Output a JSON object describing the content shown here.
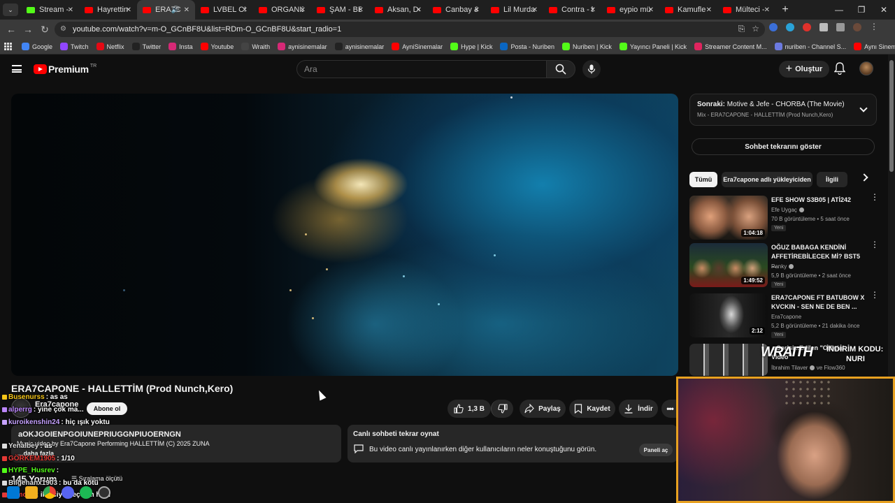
{
  "browser": {
    "tabs": [
      {
        "title": "Stream - K",
        "favicon": "kick-icon"
      },
      {
        "title": "Hayrettin",
        "favicon": "youtube-icon"
      },
      {
        "title": "ERA7C",
        "favicon": "youtube-icon",
        "active": true
      },
      {
        "title": "LVBEL C5",
        "favicon": "youtube-icon"
      },
      {
        "title": "ORGANIZE",
        "favicon": "youtube-icon"
      },
      {
        "title": "ŞAM - BEN",
        "favicon": "youtube-icon"
      },
      {
        "title": "Aksan, Der",
        "favicon": "youtube-icon"
      },
      {
        "title": "Canbay &",
        "favicon": "youtube-icon"
      },
      {
        "title": "Lil Murda",
        "favicon": "youtube-icon"
      },
      {
        "title": "Contra - b",
        "favicon": "youtube-icon"
      },
      {
        "title": "eypio mü",
        "favicon": "youtube-icon"
      },
      {
        "title": "Kamufle -",
        "favicon": "youtube-icon"
      },
      {
        "title": "Mülteci -",
        "favicon": "youtube-icon"
      }
    ],
    "url": "youtube.com/watch?v=m-O_GCnBF8U&list=RDm-O_GCnBF8U&start_radio=1",
    "bookmarks": [
      {
        "label": "Google",
        "color": "#4285f4"
      },
      {
        "label": "Twitch",
        "color": "#9146ff"
      },
      {
        "label": "Netflix",
        "color": "#e50914"
      },
      {
        "label": "Twitter",
        "color": "#222222"
      },
      {
        "label": "Insta",
        "color": "#d62976"
      },
      {
        "label": "Youtube",
        "color": "#ff0000"
      },
      {
        "label": "Wraith",
        "color": "#444444"
      },
      {
        "label": "aynisinemalar",
        "color": "#d62976"
      },
      {
        "label": "aynisinemalar",
        "color": "#222222"
      },
      {
        "label": "AyniSinemalar",
        "color": "#ff0000"
      },
      {
        "label": "Hype | Kick",
        "color": "#53fc18"
      },
      {
        "label": "Posta - Nuriben",
        "color": "#0a66c2"
      },
      {
        "label": "Nuriben | Kick",
        "color": "#53fc18"
      },
      {
        "label": "Yayıncı Paneli | Kick",
        "color": "#53fc18"
      },
      {
        "label": "Streamer Content M...",
        "color": "#e0245e"
      },
      {
        "label": "nuriben - Channel S...",
        "color": "#6c7ae0"
      },
      {
        "label": "Aynı Sinemalar - Ça...",
        "color": "#ff0000"
      }
    ]
  },
  "youtube": {
    "logo_text": "Premium",
    "logo_region": "TR",
    "search_placeholder": "Ara",
    "create_label": "Oluştur",
    "video_title": "ERA7CAPONE - HALLETTİM (Prod Nunch,Kero)",
    "channel": {
      "name": "Era7capone",
      "subscribe_label": "Abone ol"
    },
    "actions": {
      "likes": "1,3 B",
      "share": "Paylaş",
      "save": "Kaydet",
      "download": "İndir"
    },
    "description": {
      "line1": "aOKJGOIENPGOIUNEPRIUGGNPIUOERNGN",
      "line2": "Music video by Era7Capone Performing HALLETTİM (C) 2025 ZUNA",
      "more": "...daha fazla"
    },
    "live_chat_replay": {
      "title": "Canlı sohbeti tekrar oynat",
      "text": "Bu video canlı yayınlanırken diğer kullanıcıların neler konuştuğunu görün.",
      "button": "Paneli aç"
    },
    "comments": {
      "count": "145 Yorum",
      "sort_label": "Sıralama ölçütü"
    },
    "up_next": {
      "prefix": "Sonraki:",
      "title": "Motive & Jefe - CHORBA (The Movie)",
      "subtitle": "Mix - ERA7CAPONE - HALLETTİM (Prod Nunch,Kero)"
    },
    "show_chat_replay": "Sohbet tekrarını göster",
    "chips": [
      "Tümü",
      "Era7capone adlı yükleyiciden",
      "İlgili"
    ],
    "recommendations": [
      {
        "title": "EFE SHOW S3B05 | ATİ242",
        "channel": "Efe Uygaç",
        "verified": true,
        "meta": "70 B görüntüleme • 5 saat önce",
        "badge": "Yeni",
        "duration": "1:04:18"
      },
      {
        "title": "OĞUZ BABAGA KENDİNİ AFFETİREBİLECEK Mİ? BST5 ...",
        "channel": "Panky",
        "verified": true,
        "meta": "5,9 B görüntüleme • 2 saat önce",
        "badge": "Yeni",
        "duration": "1:49:52"
      },
      {
        "title": "ERA7CAPONE FT BATUBOW X KVCKIN - SEN NE DE BEN ...",
        "channel": "Era7capone",
        "verified": false,
        "meta": "5,2 B görüntüleme • 21 dakika önce",
        "badge": "Yeni",
        "duration": "2:12"
      },
      {
        "title": "...Sorisi...Edilen \"Official Video\"",
        "channel": "İbrahim Tilaver",
        "channel_suffix": "ve Flow360",
        "verified": true,
        "meta": "",
        "badge": "",
        "duration": ""
      }
    ]
  },
  "stream_overlay": {
    "chat": [
      {
        "user": "Busenurss",
        "msg": ": as as",
        "color": "#f5c518"
      },
      {
        "user": "alperrg",
        "msg": ": yine çok ma...",
        "color": "#bb86fc"
      },
      {
        "user": "kuroikenshin24",
        "msg": ": hiç ışık yoktu",
        "color": "#c6a2ff"
      },
      {
        "user": "Yenalbey",
        "msg": ": as",
        "color": "#dddddd"
      },
      {
        "user": "GÖRKEM1905",
        "msg": ": 1/10",
        "color": "#e53935"
      },
      {
        "user": "HYPE_Husrev",
        "msg": ":",
        "color": "#53fc18"
      },
      {
        "user": "Bilgehanx1903",
        "msg": ": bu da kötü",
        "color": "#dddddd"
      },
      {
        "user": "Lamos8",
        "msg": ": ikinciye geçelim hadi",
        "color": "#e53935"
      }
    ],
    "ad_brand": "WRAITH",
    "ad_code_label": "İNDİRİM KODU:",
    "ad_code": "NURI"
  },
  "colors": {
    "background": "#0f0f0f",
    "surface": "#272727",
    "text": "#f1f1f1",
    "brand_red": "#ff0000",
    "webcam_border": "#e8a120"
  }
}
